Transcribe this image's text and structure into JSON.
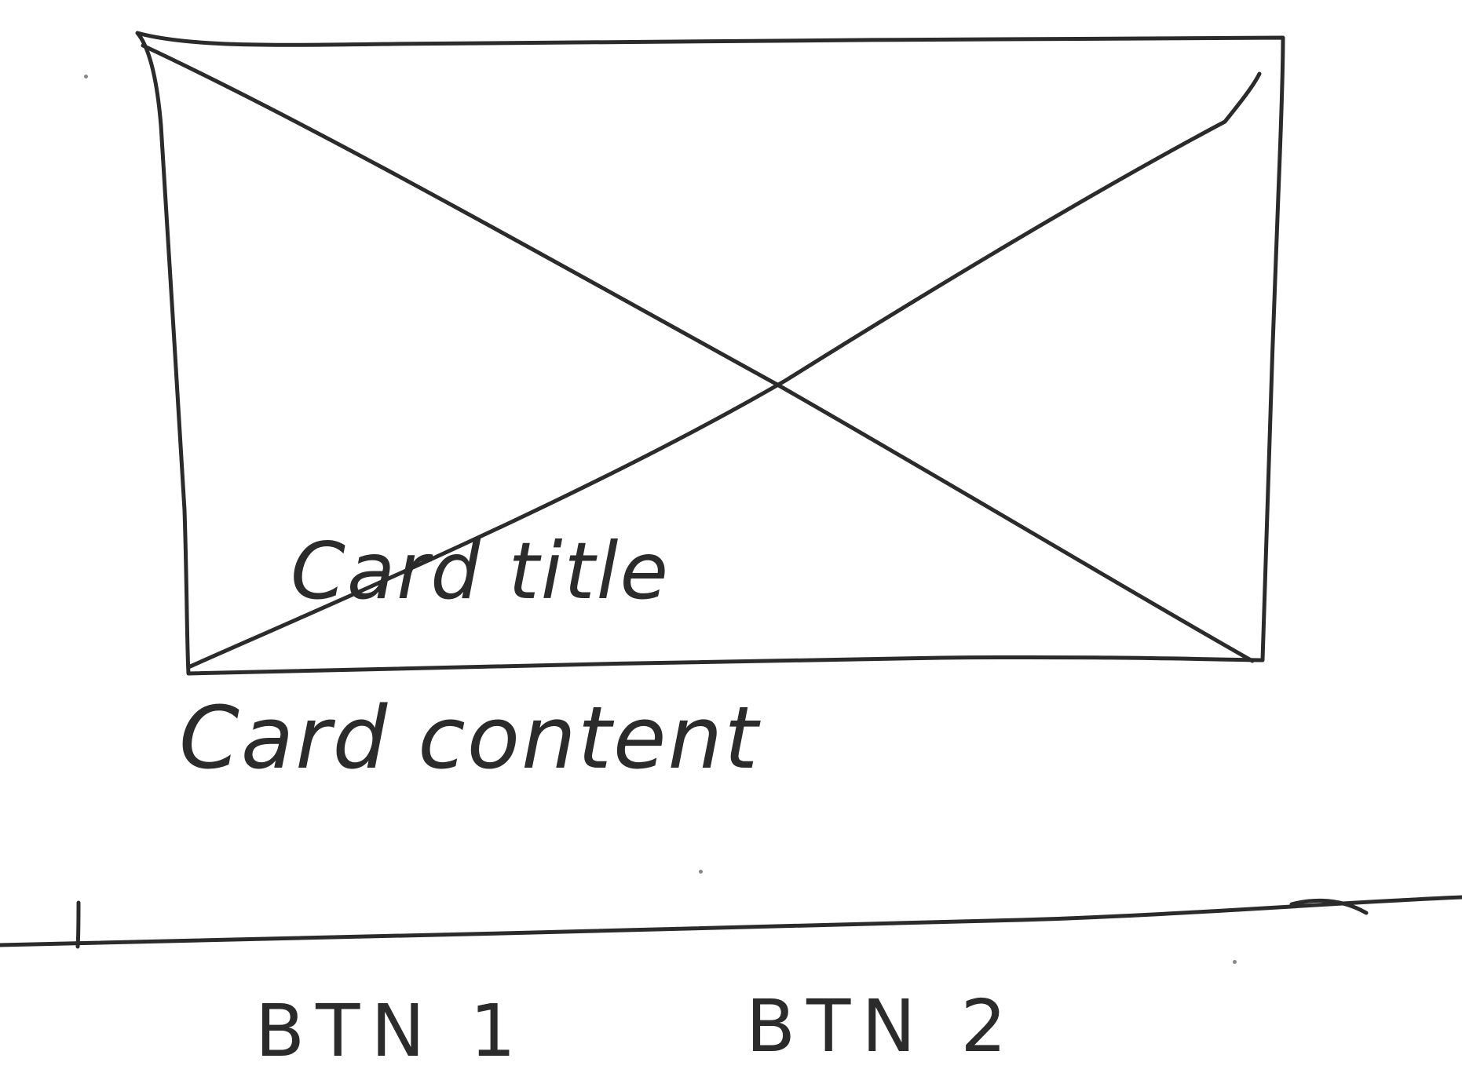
{
  "card": {
    "title": "Card title",
    "content": "Card content",
    "image_placeholder": "image-placeholder-icon"
  },
  "actions": {
    "btn1_label": "BTN 1",
    "btn2_label": "BTN 2"
  },
  "colors": {
    "ink": "#2b2b2b",
    "paper": "#ffffff"
  }
}
